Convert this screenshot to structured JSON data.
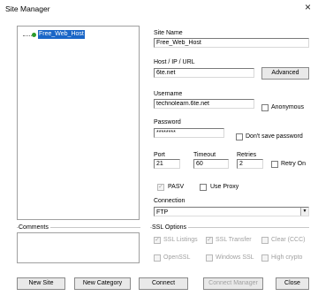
{
  "window": {
    "title": "Site Manager",
    "close_glyph": "×"
  },
  "tree": {
    "items": [
      {
        "label": "Free_Web_Host"
      }
    ]
  },
  "site_name": {
    "label": "Site Name",
    "value": "Free_Web_Host"
  },
  "host": {
    "label": "Host / IP / URL",
    "value": "6te.net",
    "advanced_label": "Advanced"
  },
  "username": {
    "label": "Username",
    "value": "technolearn.6te.net",
    "anonymous_label": "Anonymous"
  },
  "password": {
    "label": "Password",
    "value": "********",
    "dont_save_label": "Don't save password"
  },
  "port": {
    "label": "Port",
    "value": "21"
  },
  "timeout": {
    "label": "Timeout",
    "value": "60"
  },
  "retries": {
    "label": "Retries",
    "value": "2",
    "retry_on_label": "Retry On"
  },
  "pasv": {
    "label": "PASV",
    "checked": true
  },
  "use_proxy": {
    "label": "Use Proxy",
    "checked": false
  },
  "connection": {
    "label": "Connection",
    "value": "FTP"
  },
  "comments": {
    "label": "Comments",
    "value": ""
  },
  "ssl": {
    "label": "SSL Options",
    "ssl_listings": "SSL Listings",
    "ssl_transfer": "SSL Transfer",
    "clear_ccc": "Clear (CCC)",
    "openssl": "OpenSSL",
    "windows_ssl": "Windows SSL",
    "high_crypto": "High crypto"
  },
  "buttons": {
    "new_site": "New Site",
    "new_category": "New Category",
    "connect": "Connect",
    "connect_manager": "Connect Manager",
    "close": "Close"
  },
  "colors": {
    "selection": "#1a66c7",
    "tree_dot": "#2a9a2a"
  }
}
